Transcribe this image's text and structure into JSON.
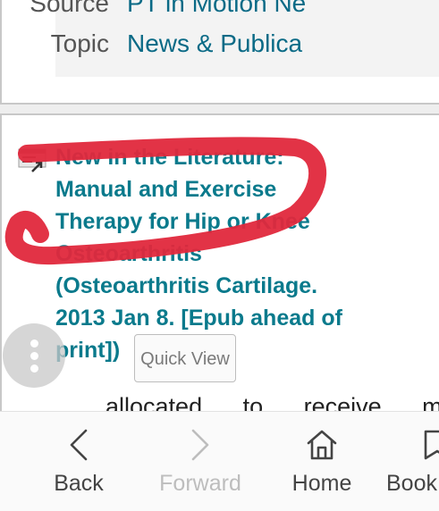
{
  "meta": {
    "source_label": "Source",
    "source_value": "PT in Motion Ne",
    "topic_label": "Topic",
    "topic_value": "News & Publica"
  },
  "article": {
    "title_lines": [
      "New in the Literature:",
      "Manual and Exercise",
      "Therapy for Hip or Knee",
      "Osteoarthritis",
      "(Osteoarthritis Cartilage.",
      "2013 Jan 8. [Epub ahead of",
      "print])"
    ],
    "quick_view_label": "Quick View",
    "abstract_snippet": "allocated to receive ma"
  },
  "nav": {
    "back_label": "Back",
    "forward_label": "Forward",
    "home_label": "Home",
    "bookmarks_label": "Book"
  },
  "colors": {
    "link_teal": "#0a7a8c",
    "annotation_red": "#e0283c",
    "disabled_gray": "#bdbdbd"
  }
}
